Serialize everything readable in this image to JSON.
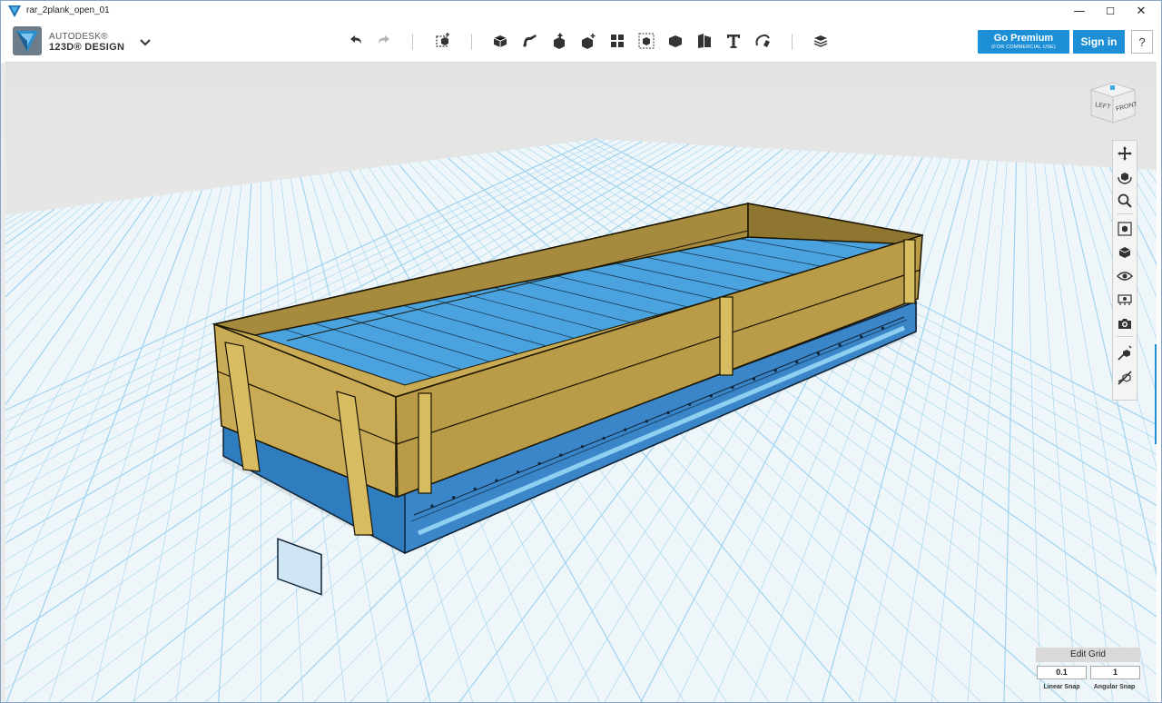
{
  "window": {
    "title": "rar_2plank_open_01",
    "controls": {
      "minimize": "—",
      "maximize": "☐",
      "close": "✕"
    }
  },
  "brand": {
    "line1": "AUTODESK®",
    "line2": "123D® DESIGN",
    "menu_icon": "chevron-down-icon"
  },
  "toolbar": {
    "tools": [
      {
        "name": "undo",
        "icon": "undo-icon"
      },
      {
        "name": "redo",
        "icon": "redo-icon"
      },
      {
        "name": "transform",
        "icon": "transform-icon"
      },
      {
        "name": "primitives",
        "icon": "primitives-icon"
      },
      {
        "name": "sketch",
        "icon": "sketch-icon"
      },
      {
        "name": "construct",
        "icon": "construct-icon"
      },
      {
        "name": "modify",
        "icon": "modify-icon"
      },
      {
        "name": "pattern",
        "icon": "pattern-icon"
      },
      {
        "name": "grouping",
        "icon": "grouping-icon"
      },
      {
        "name": "combine",
        "icon": "combine-icon"
      },
      {
        "name": "measure",
        "icon": "measure-icon"
      },
      {
        "name": "text",
        "icon": "text-icon"
      },
      {
        "name": "snap",
        "icon": "snap-icon"
      },
      {
        "name": "material",
        "icon": "material-icon"
      }
    ]
  },
  "account": {
    "premium_label": "Go Premium",
    "premium_sub": "(FOR COMMERCIAL USE)",
    "signin_label": "Sign in",
    "help_label": "?"
  },
  "viewcube": {
    "left_label": "LEFT",
    "front_label": "FRONT"
  },
  "navbar": {
    "items": [
      "pan-icon",
      "orbit-icon",
      "zoom-icon",
      "fit-icon",
      "view-icon",
      "visibility-icon",
      "materials-icon",
      "screenshot-icon",
      "snap-tool-icon",
      "hide-tool-icon"
    ]
  },
  "snap": {
    "edit_grid_label": "Edit Grid",
    "linear_value": "0.1",
    "angular_value": "1",
    "linear_label": "Linear Snap",
    "angular_label": "Angular Snap"
  },
  "colors": {
    "accent": "#1d8fd6",
    "grid_line": "#9fd3ee",
    "grid_bg": "#eef6fa",
    "wood": "#bca04c",
    "wood_dark": "#8e7530",
    "chassis": "#3a86c8",
    "floor": "#5db1e6"
  }
}
